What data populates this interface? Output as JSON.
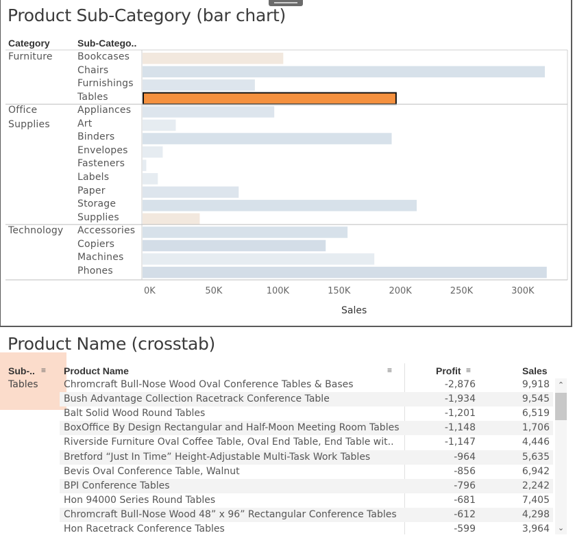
{
  "sheet1": {
    "title": "Product Sub-Category (bar chart)",
    "col_category": "Category",
    "col_subcategory": "Sub-Catego..",
    "axis_title": "Sales"
  },
  "chart_data": {
    "type": "bar",
    "orientation": "horizontal",
    "xlabel": "Sales",
    "xlim": [
      0,
      340000
    ],
    "ticks": [
      "0K",
      "50K",
      "100K",
      "150K",
      "200K",
      "250K",
      "300K"
    ],
    "tick_values": [
      0,
      50000,
      100000,
      150000,
      200000,
      250000,
      300000
    ],
    "groups": [
      {
        "category_lines": [
          "Furniture"
        ],
        "items": [
          {
            "name": "Bookcases",
            "value": 114880,
            "color": "#f2e8de"
          },
          {
            "name": "Chairs",
            "value": 328449,
            "color": "#d7e1ea"
          },
          {
            "name": "Furnishings",
            "value": 91705,
            "color": "#dde5ed"
          },
          {
            "name": "Tables",
            "value": 206966,
            "color": "#f5913f",
            "selected": true
          }
        ]
      },
      {
        "category_lines": [
          "Office",
          "Supplies"
        ],
        "items": [
          {
            "name": "Appliances",
            "value": 107532,
            "color": "#dde5ed"
          },
          {
            "name": "Art",
            "value": 27119,
            "color": "#e6ecf1"
          },
          {
            "name": "Binders",
            "value": 203413,
            "color": "#d7e1ea"
          },
          {
            "name": "Envelopes",
            "value": 16476,
            "color": "#e6ecf1"
          },
          {
            "name": "Fasteners",
            "value": 3024,
            "color": "#e6ecf1"
          },
          {
            "name": "Labels",
            "value": 12486,
            "color": "#e6ecf1"
          },
          {
            "name": "Paper",
            "value": 78479,
            "color": "#dde5ed"
          },
          {
            "name": "Storage",
            "value": 223844,
            "color": "#d7e1ea"
          },
          {
            "name": "Supplies",
            "value": 46674,
            "color": "#f2e8de"
          }
        ]
      },
      {
        "category_lines": [
          "Technology"
        ],
        "items": [
          {
            "name": "Accessories",
            "value": 167380,
            "color": "#d7e1ea"
          },
          {
            "name": "Copiers",
            "value": 149528,
            "color": "#d3dde7"
          },
          {
            "name": "Machines",
            "value": 189239,
            "color": "#e6ecf1"
          },
          {
            "name": "Phones",
            "value": 330007,
            "color": "#d3dde7"
          }
        ]
      }
    ]
  },
  "sheet2": {
    "title": "Product Name (crosstab)",
    "col_sub": "Sub-..",
    "col_product": "Product Name",
    "col_profit": "Profit",
    "col_sales": "Sales",
    "sub_value": "Tables",
    "rows": [
      {
        "name": "Chromcraft Bull-Nose Wood Oval Conference Tables & Bases",
        "profit": "-2,876",
        "sales": "9,918"
      },
      {
        "name": "Bush Advantage Collection Racetrack Conference Table",
        "profit": "-1,934",
        "sales": "9,545"
      },
      {
        "name": "Balt Solid Wood Round Tables",
        "profit": "-1,201",
        "sales": "6,519"
      },
      {
        "name": "BoxOffice By Design Rectangular and Half-Moon Meeting Room Tables",
        "profit": "-1,148",
        "sales": "1,706"
      },
      {
        "name": "Riverside Furniture Oval Coffee Table, Oval End Table, End Table wit..",
        "profit": "-1,147",
        "sales": "4,446"
      },
      {
        "name": "Bretford “Just In Time” Height-Adjustable Multi-Task Work Tables",
        "profit": "-964",
        "sales": "5,635"
      },
      {
        "name": "Bevis Oval Conference Table, Walnut",
        "profit": "-856",
        "sales": "6,942"
      },
      {
        "name": "BPI Conference Tables",
        "profit": "-796",
        "sales": "2,242"
      },
      {
        "name": "Hon 94000 Series Round Tables",
        "profit": "-681",
        "sales": "7,405"
      },
      {
        "name": "Chromcraft Bull-Nose Wood 48” x 96” Rectangular Conference Tables",
        "profit": "-612",
        "sales": "4,298"
      },
      {
        "name": "Hon Racetrack Conference Tables",
        "profit": "-599",
        "sales": "3,964"
      }
    ]
  },
  "icons": {
    "sort": "sort-icon",
    "scroll_up": "chevron-up-icon",
    "scroll_down": "chevron-down-icon"
  }
}
